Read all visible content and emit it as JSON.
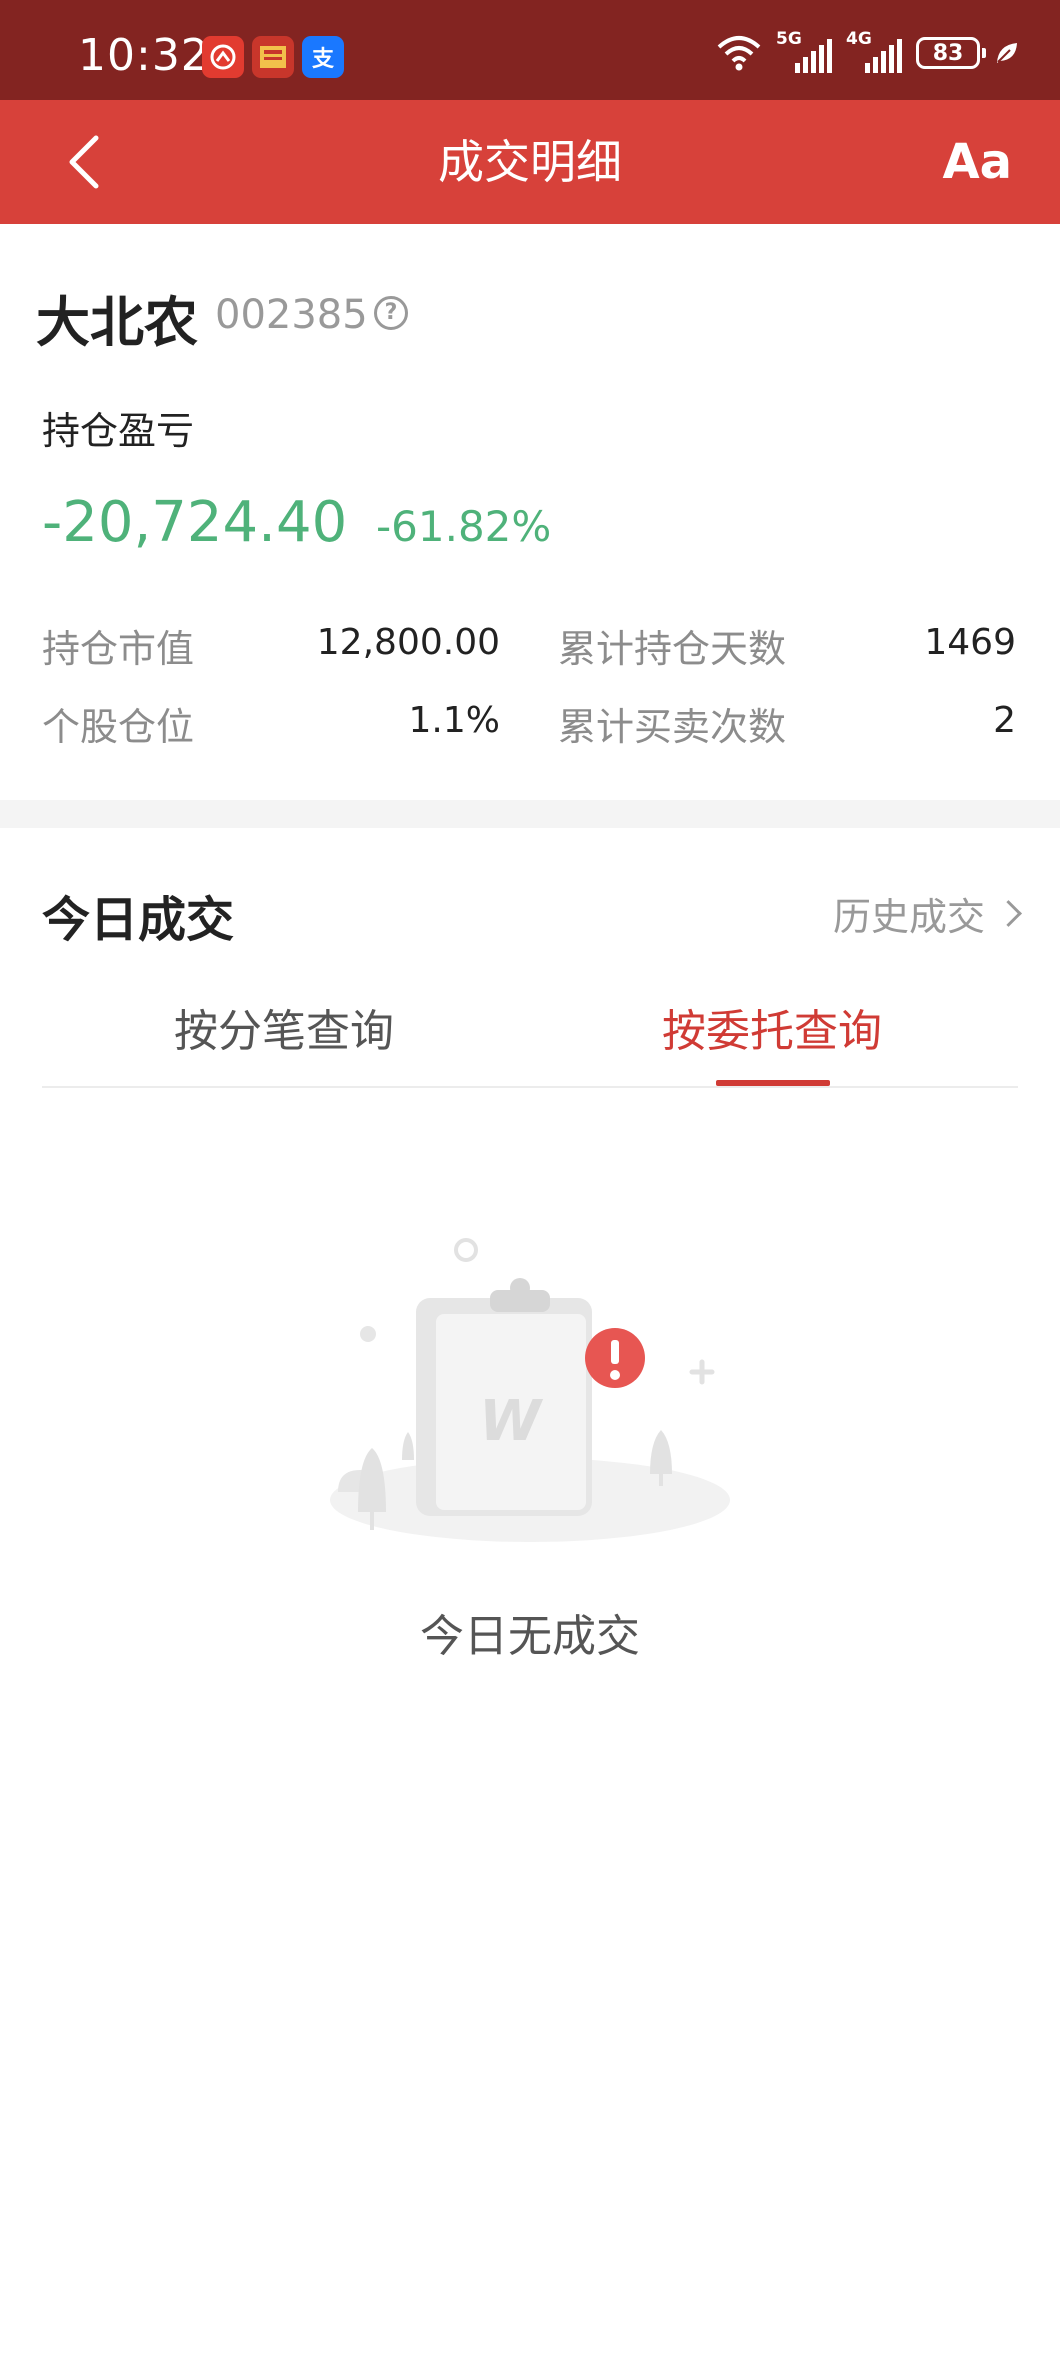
{
  "status_bar": {
    "time": "10:32",
    "apps": [
      {
        "icon": "netease-app-icon",
        "color": "#e23b30"
      },
      {
        "icon": "news-app-icon",
        "color": "#c8362b"
      },
      {
        "icon": "alipay-icon",
        "glyph": "支",
        "color": "#1a78ff"
      }
    ],
    "signal1": "5G",
    "signal2": "4G",
    "battery": "83"
  },
  "nav": {
    "title": "成交明细",
    "font_button": "Aa"
  },
  "stock": {
    "name": "大北农",
    "code": "002385",
    "pl_label": "持仓盈亏",
    "pl_value": "-20,724.40",
    "pl_pct": "-61.82%",
    "stats": [
      {
        "label": "持仓市值",
        "value": "12,800.00"
      },
      {
        "label": "累计持仓天数",
        "value": "1469"
      },
      {
        "label": "个股仓位",
        "value": "1.1%"
      },
      {
        "label": "累计买卖次数",
        "value": "2"
      }
    ]
  },
  "today": {
    "title": "今日成交",
    "history_link": "历史成交",
    "tabs": [
      "按分笔查询",
      "按委托查询"
    ],
    "active_tab": 1,
    "empty_text": "今日无成交"
  },
  "colors": {
    "status_bar": "#832421",
    "nav_bar": "#d7413a",
    "loss_green": "#4fb27a",
    "active_tab": "#d03b35"
  }
}
